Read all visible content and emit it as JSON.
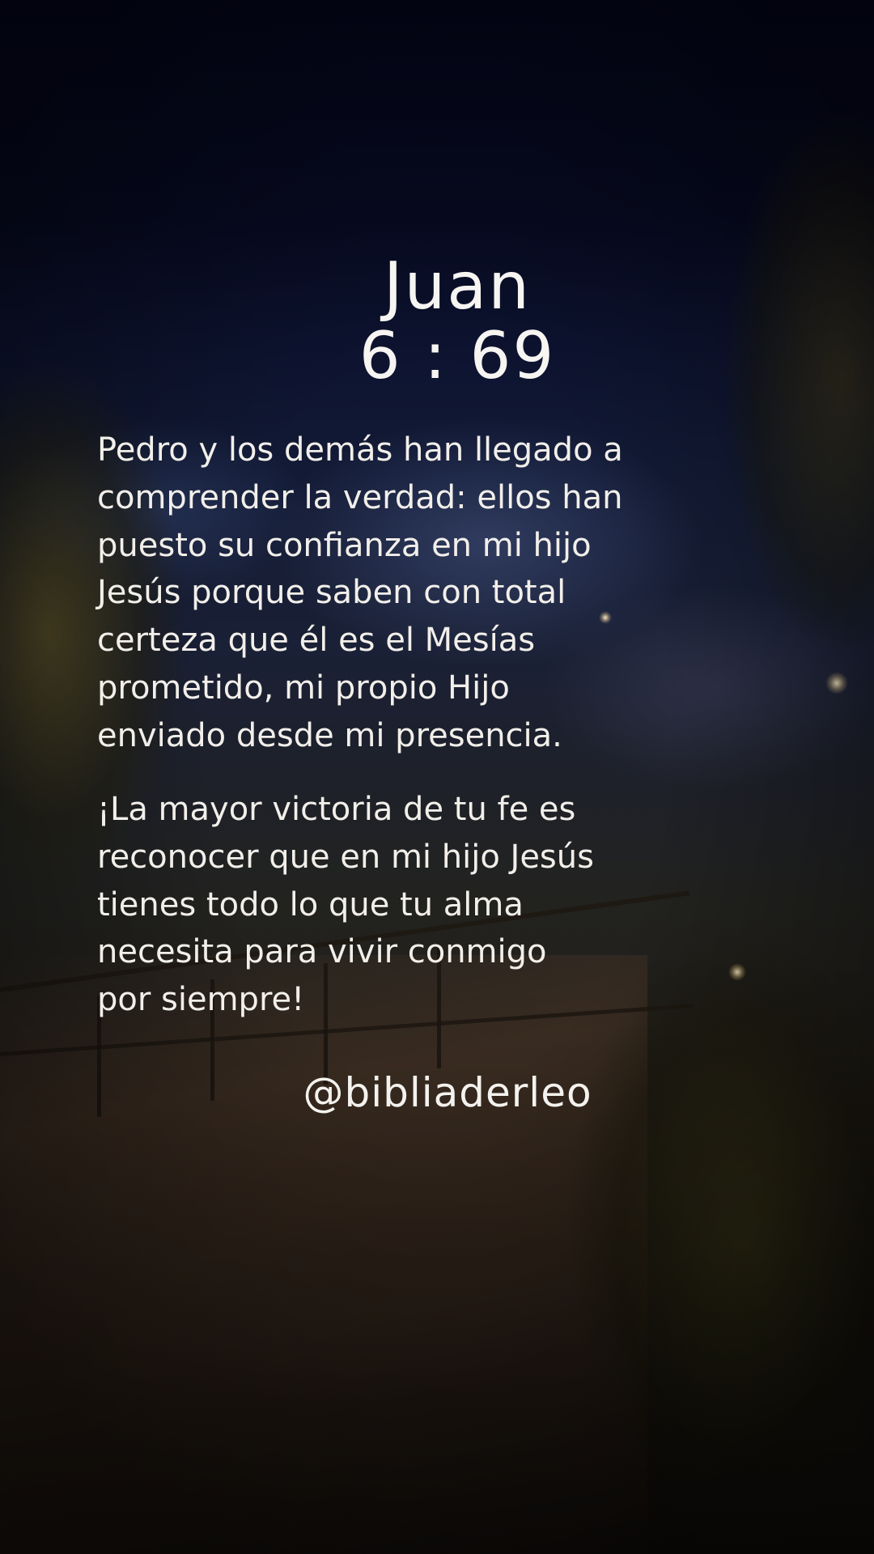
{
  "verse": {
    "book": "Juan",
    "reference": "6 : 69"
  },
  "paragraph1": [
    "Pedro y los demás han llegado a",
    "comprender la verdad: ellos han",
    "puesto su confianza en mi hijo",
    "Jesús porque saben con total",
    "certeza que él es el Mesías",
    "prometido, mi propio Hijo",
    "enviado desde mi presencia."
  ],
  "paragraph2": [
    "¡La mayor victoria de tu fe es",
    "reconocer que en mi hijo Jesús",
    "tienes todo lo que tu alma",
    "necesita para vivir conmigo",
    "por siempre!"
  ],
  "author_handle": "@bibliaderleo",
  "colors": {
    "text": "#f4f2ee",
    "sky": "#07091a",
    "foliage": "#5f521e"
  }
}
